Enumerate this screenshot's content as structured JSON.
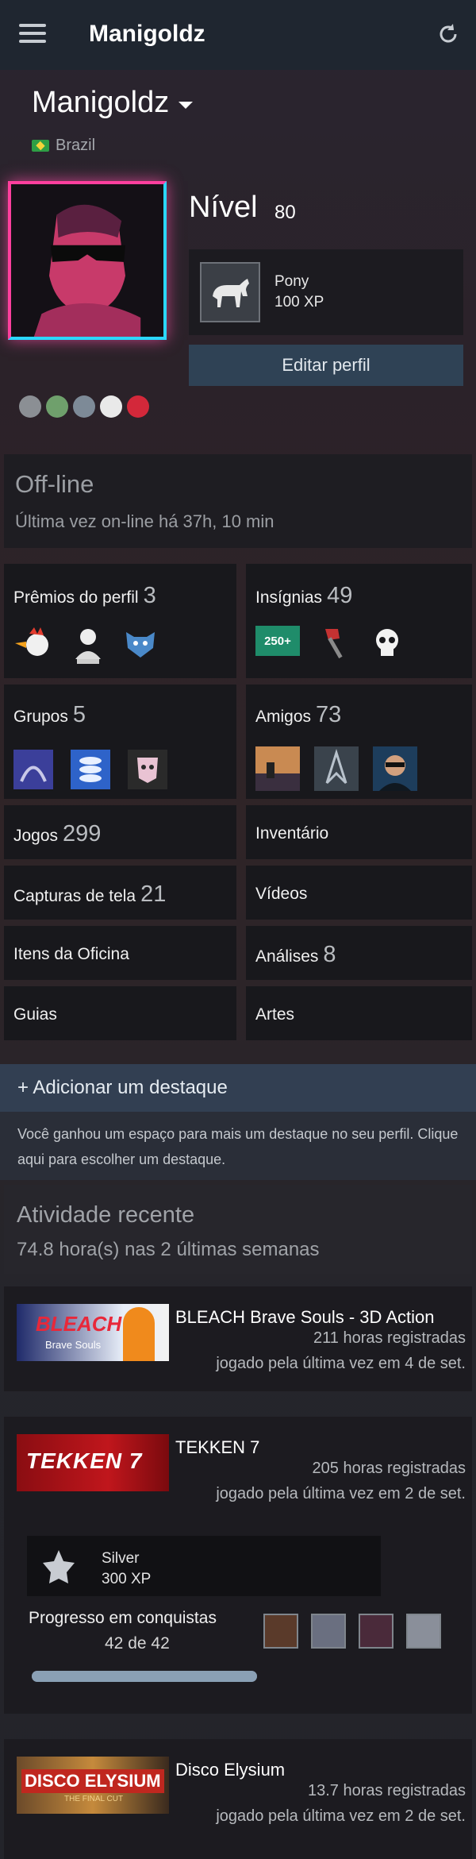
{
  "app": {
    "title": "Manigoldz"
  },
  "profile": {
    "name": "Manigoldz",
    "country": "Brazil",
    "level_label": "Nível",
    "level": "80",
    "featured_badge": {
      "name": "Pony",
      "xp": "100 XP"
    },
    "edit_button": "Editar perfil"
  },
  "status": {
    "title": "Off-line",
    "last_online": "Última vez on-line há 37h, 10 min"
  },
  "tiles": {
    "awards": {
      "label": "Prêmios do perfil",
      "count": "3"
    },
    "badges": {
      "label": "Insígnias",
      "count": "49",
      "badge_text": "250+"
    },
    "groups": {
      "label": "Grupos",
      "count": "5"
    },
    "friends": {
      "label": "Amigos",
      "count": "73"
    },
    "games": {
      "label": "Jogos",
      "count": "299"
    },
    "inventory": {
      "label": "Inventário"
    },
    "screenshots": {
      "label": "Capturas de tela",
      "count": "21"
    },
    "videos": {
      "label": "Vídeos"
    },
    "workshop": {
      "label": "Itens da Oficina"
    },
    "reviews": {
      "label": "Análises",
      "count": "8"
    },
    "guides": {
      "label": "Guias"
    },
    "artwork": {
      "label": "Artes"
    }
  },
  "highlight": {
    "title": "+ Adicionar um destaque",
    "description": "Você ganhou um espaço para mais um destaque no seu perfil. Clique aqui para escolher um destaque."
  },
  "recent": {
    "title": "Atividade recente",
    "summary": "74.8 hora(s) nas 2 últimas semanas"
  },
  "games": [
    {
      "name": "BLEACH Brave Souls - 3D Action",
      "hours": "211 horas registradas",
      "last_played": "jogado pela última vez em 4 de set.",
      "capsule_text": "BLEACH",
      "capsule_sub": "Brave Souls"
    },
    {
      "name": "TEKKEN 7",
      "hours": "205 horas registradas",
      "last_played": "jogado pela última vez em 2 de set.",
      "capsule_text": "TEKKEN 7"
    },
    {
      "name": "Disco Elysium",
      "hours": "13.7 horas registradas",
      "last_played": "jogado pela última vez em 2 de set.",
      "capsule_text": "DISCO ELYSIUM",
      "capsule_sub": "THE FINAL CUT"
    }
  ],
  "tekken_achievements": {
    "badge_name": "Silver",
    "badge_xp": "300 XP",
    "label": "Progresso em conquistas",
    "count": "42 de 42",
    "progress": 1.0
  },
  "colors": {
    "accent": "#2f4255",
    "topbar": "#1f2630",
    "tile": "#18181c"
  }
}
